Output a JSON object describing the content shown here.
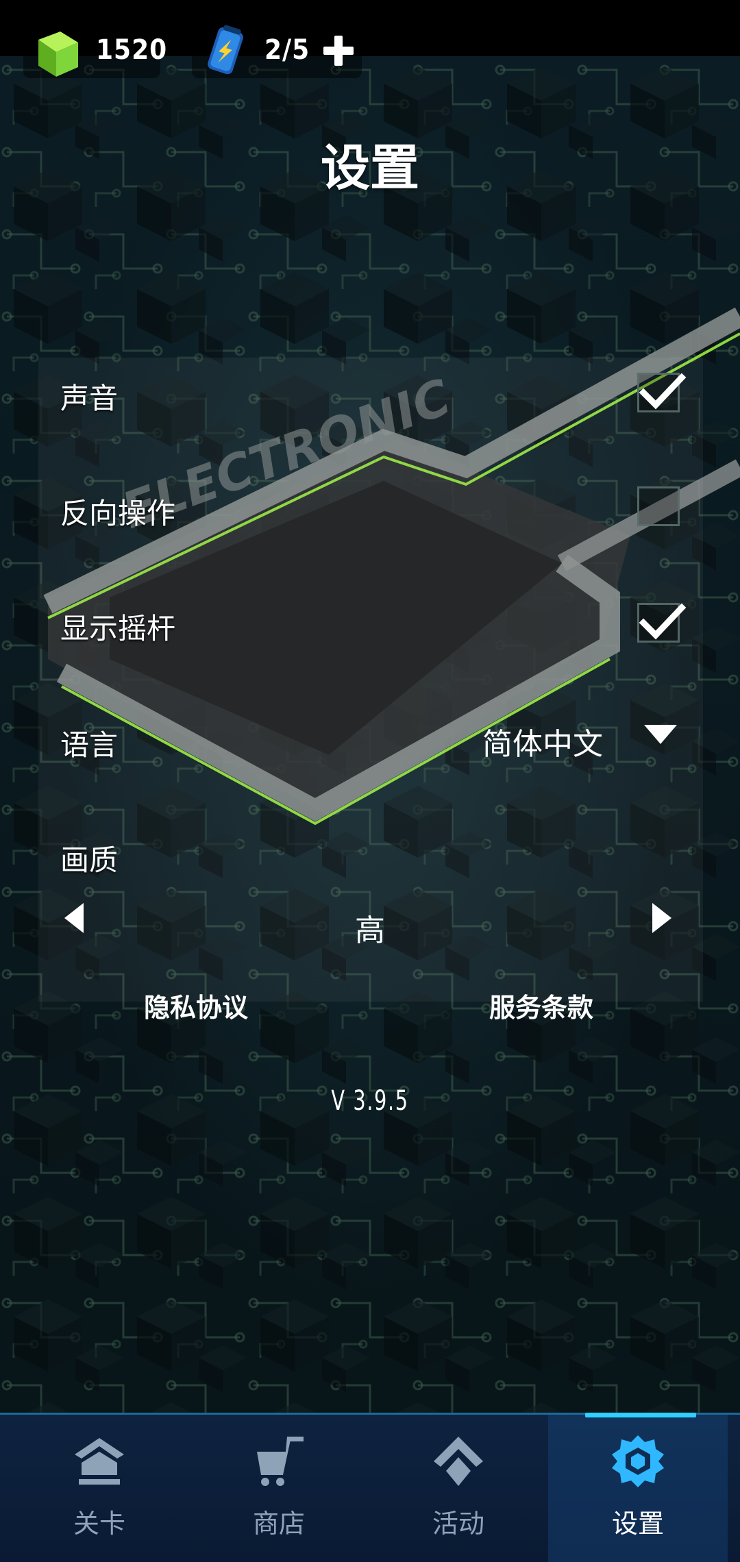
{
  "currency": {
    "gems": "1520",
    "energy": "2/5",
    "gem_icon": "green-gem-icon",
    "energy_icon": "battery-icon",
    "plus_icon": "plus-icon"
  },
  "title": "设置",
  "background_text": "ELECTRONIC",
  "settings": {
    "sound": {
      "label": "声音",
      "checked": true
    },
    "reverse_control": {
      "label": "反向操作",
      "checked": false
    },
    "show_joystick": {
      "label": "显示摇杆",
      "checked": true
    },
    "language": {
      "label": "语言",
      "value": "简体中文"
    },
    "quality": {
      "label": "画质",
      "value": "高"
    }
  },
  "links": {
    "privacy": "隐私协议",
    "terms": "服务条款"
  },
  "version": "V 3.9.5",
  "nav": {
    "tabs": [
      {
        "label": "关卡",
        "icon": "levels-icon",
        "active": false
      },
      {
        "label": "商店",
        "icon": "cart-icon",
        "active": false
      },
      {
        "label": "活动",
        "icon": "event-icon",
        "active": false
      },
      {
        "label": "设置",
        "icon": "gear-icon",
        "active": true
      }
    ],
    "active_color": "#2fd0ff"
  },
  "colors": {
    "accent": "#2fd0ff",
    "gem": "#7fd63a",
    "wall_glow": "#8bd63a"
  }
}
